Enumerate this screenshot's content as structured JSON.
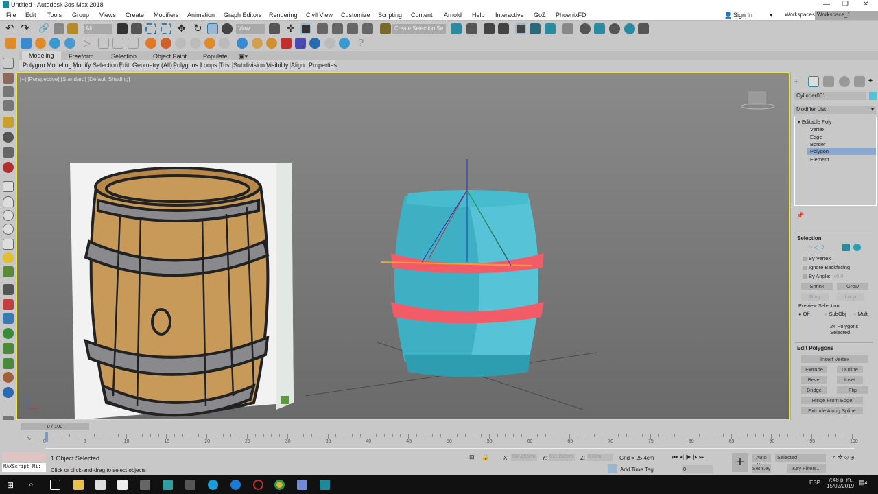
{
  "window": {
    "title": "Untitled - Autodesk 3ds Max 2018"
  },
  "menu": [
    "File",
    "Edit",
    "Tools",
    "Group",
    "Views",
    "Create",
    "Modifiers",
    "Animation",
    "Graph Editors",
    "Rendering",
    "Civil View",
    "Customize",
    "Scripting",
    "Content",
    "Arnold",
    "Help",
    "Interactive",
    "GoZ",
    "PhoenixFD"
  ],
  "account": {
    "sign_in": "Sign In",
    "workspaces_label": "Workspaces:",
    "workspace": "Workspace_1"
  },
  "toolbar": {
    "filter": "All",
    "ref_coord": "View",
    "selection_set": "Create Selection Se"
  },
  "ribbon": {
    "tabs": [
      "Modeling",
      "Freeform",
      "Selection",
      "Object Paint",
      "Populate"
    ],
    "panels": [
      "Polygon Modeling",
      "Modify Selection",
      "Edit",
      "Geometry (All)",
      "Polygons",
      "Loops",
      "Tris",
      "Subdivision",
      "Visibility",
      "Align",
      "Properties"
    ]
  },
  "viewport": {
    "label": "[+] [Perspective] [Standard] [Default Shading]"
  },
  "command_panel": {
    "object_name": "Cylinder001",
    "object_color": "#4fc3d8",
    "modifier_list": "Modifier List",
    "stack": {
      "root": "Editable Poly",
      "items": [
        "Vertex",
        "Edge",
        "Border",
        "Polygon",
        "Element"
      ],
      "selected": "Polygon"
    },
    "selection": {
      "title": "Selection",
      "by_vertex": "By Vertex",
      "ignore_backfacing": "Ignore Backfacing",
      "by_angle": "By Angle:",
      "angle": "45,0",
      "shrink": "Shrink",
      "grow": "Grow",
      "ring": "Ring",
      "loop": "Loop",
      "preview_title": "Preview Selection",
      "preview_options": [
        "Off",
        "SubObj",
        "Multi"
      ],
      "count": "24 Polygons Selected"
    },
    "edit_polygons": {
      "title": "Edit Polygons",
      "insert_vertex": "Insert Vertex",
      "extrude": "Extrude",
      "outline": "Outline",
      "bevel": "Bevel",
      "inset": "Inset",
      "bridge": "Bridge",
      "flip": "Flip",
      "hinge": "Hinge From Edge",
      "extrude_spline": "Extrude Along Spline"
    }
  },
  "timeline": {
    "frame": "0 / 100",
    "ticks": [
      "0",
      "5",
      "10",
      "15",
      "20",
      "25",
      "30",
      "35",
      "40",
      "45",
      "50",
      "55",
      "60",
      "65",
      "70",
      "75",
      "80",
      "85",
      "90",
      "95",
      "100"
    ]
  },
  "status": {
    "maxscript": "MAXScript Mi:",
    "selected": "1 Object Selected",
    "prompt": "Click or click-and-drag to select objects",
    "x_label": "X:",
    "x": "504,255cm",
    "y_label": "Y:",
    "y": "611,202cm",
    "z_label": "Z:",
    "z": "0,0cm",
    "grid": "Grid = 25,4cm",
    "add_time_tag": "Add Time Tag",
    "auto_key": "Auto Key",
    "set_key": "Set Key",
    "key_mode": "Selected",
    "key_filters": "Key Filters...",
    "current_frame": "0"
  },
  "taskbar": {
    "lang": "ESP",
    "time": "7:48 p. m.",
    "date": "15/02/2019",
    "notifications": "4"
  }
}
